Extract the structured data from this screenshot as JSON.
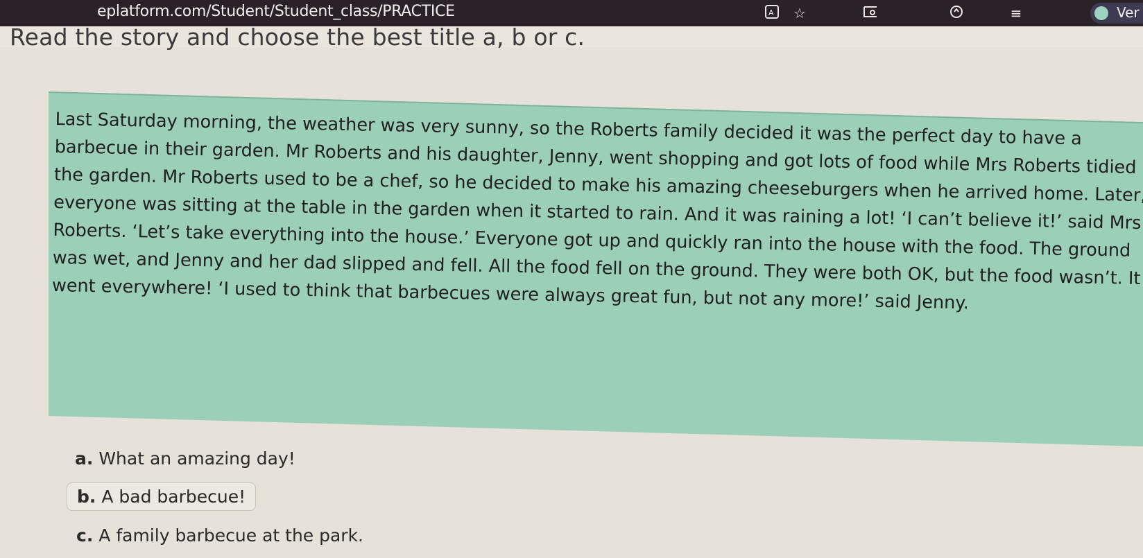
{
  "browser": {
    "url": "eplatform.com/Student/Student_class/PRACTICE",
    "profile_label": "Ver",
    "icons": [
      "translate-icon",
      "star-icon",
      "reading-mode-icon",
      "extension-icon",
      "playlist-icon"
    ]
  },
  "exercise": {
    "instruction": "Read the story and choose the best title a, b or c.",
    "story_lines": [
      "Last Saturday morning, the weather was very sunny, so the Roberts family decided it was the perfect day to have a",
      "barbecue in their garden. Mr Roberts and his daughter, Jenny, went shopping and got lots of food while Mrs Roberts tidied",
      "the garden. Mr Roberts used to be a chef, so he decided to make his amazing cheeseburgers when he arrived home. Later,",
      "everyone was sitting at the table in the garden when it started to rain. And it was raining a lot! ‘I can’t believe it!’ said Mrs",
      "Roberts. ‘Let’s take everything into the house.’ Everyone got up and quickly ran into the house with the food. The ground",
      "was wet, and Jenny and her dad slipped and fell. All the food fell on the ground. They were both OK, but the food wasn’t. It",
      "went everywhere! ‘I used to think that barbecues were always great fun, but not any more!’ said Jenny."
    ],
    "options": [
      {
        "letter": "a.",
        "text": "What an amazing day!"
      },
      {
        "letter": "b.",
        "text": "A bad barbecue!"
      },
      {
        "letter": "c.",
        "text": "A family barbecue at the park."
      }
    ]
  },
  "colors": {
    "story_background": "#9ccfb8",
    "page_background": "#e6e2d9",
    "browser_bar": "#2b2228"
  }
}
